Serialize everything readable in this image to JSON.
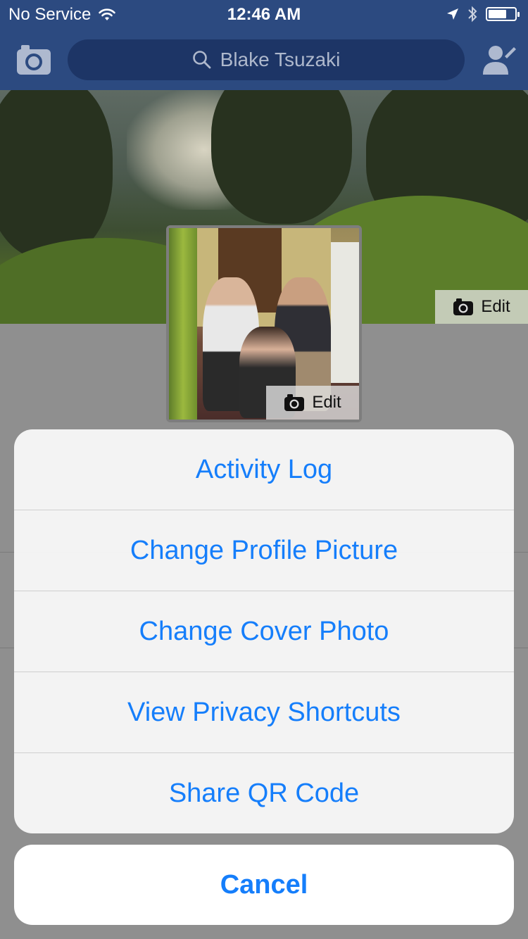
{
  "status_bar": {
    "carrier": "No Service",
    "time": "12:46 AM",
    "battery_level": 0.7
  },
  "nav": {
    "search_value": "Blake Tsuzaki",
    "camera_icon": "camera-icon",
    "friend_icon": "friend-request-icon",
    "bar_color": "#2c4a80"
  },
  "cover": {
    "edit_label": "Edit"
  },
  "profile_picture": {
    "edit_label": "Edit"
  },
  "action_sheet": {
    "items": [
      {
        "label": "Activity Log"
      },
      {
        "label": "Change Profile Picture"
      },
      {
        "label": "Change Cover Photo"
      },
      {
        "label": "View Privacy Shortcuts"
      },
      {
        "label": "Share QR Code"
      }
    ],
    "cancel_label": "Cancel",
    "accent_color": "#157efb"
  }
}
